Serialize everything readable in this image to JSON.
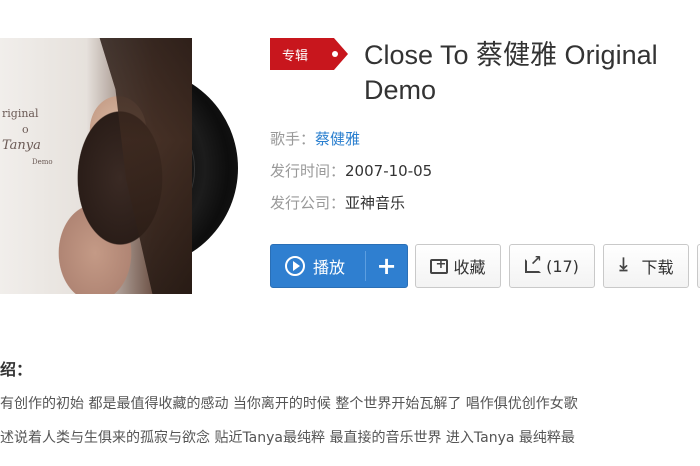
{
  "album": {
    "tag_label": "专辑",
    "title": "Close To 蔡健雅 Original Demo",
    "cover": {
      "text_line1": "riginal",
      "text_line2": "o",
      "signature": "Tanya",
      "text_small": "Demo"
    }
  },
  "meta": {
    "artist_label": "歌手：",
    "artist_value": "蔡健雅",
    "release_label": "发行时间：",
    "release_value": "2007-10-05",
    "company_label": "发行公司：",
    "company_value": "亚神音乐"
  },
  "actions": {
    "play_label": "播放",
    "add_label": "+",
    "collect_label": "收藏",
    "share_label": "(17)",
    "download_label": "下载"
  },
  "intro": {
    "heading": "绍：",
    "line1": "有创作的初始 都是最值得收藏的感动 当你离开的时候 整个世界开始瓦解了 唱作俱优创作女歌",
    "line2": "述说着人类与生俱来的孤寂与欲念 贴近Tanya最纯粹 最直接的音乐世界 进入Tanya 最纯粹最"
  },
  "colors": {
    "tag_red": "#c8161d",
    "link_blue": "#2a7fcf",
    "play_blue": "#2f7fd0"
  },
  "icons": [
    "play-icon",
    "collect-icon",
    "share-icon",
    "download-icon"
  ]
}
